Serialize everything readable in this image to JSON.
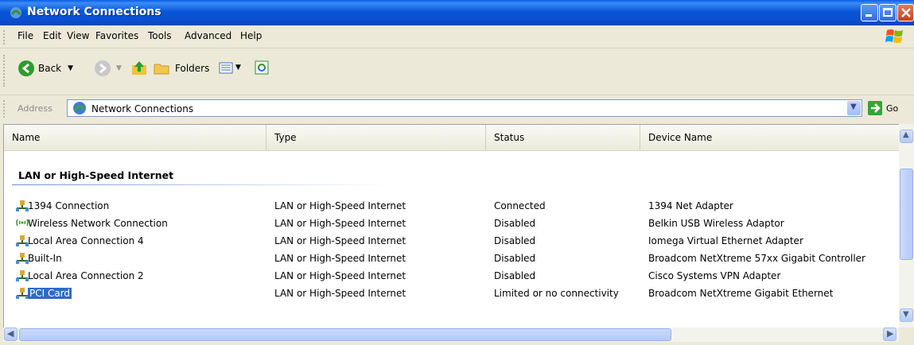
{
  "window": {
    "title": "Network Connections",
    "title_icon": "network-connections-icon",
    "controls": [
      "minimize-icon",
      "maximize-icon",
      "close-icon"
    ]
  },
  "menu": {
    "items": [
      {
        "label": "File"
      },
      {
        "label": "Edit"
      },
      {
        "label": "View"
      },
      {
        "label": "Favorites"
      },
      {
        "label": "Tools"
      },
      {
        "label": "Advanced"
      },
      {
        "label": "Help"
      }
    ]
  },
  "toolbar": {
    "back_label": "Back",
    "folders_label": "Folders"
  },
  "address": {
    "label": "Address",
    "value": "Network Connections",
    "go_label": "Go"
  },
  "columns": [
    "Name",
    "Type",
    "Status",
    "Device Name"
  ],
  "group": {
    "title": "LAN or High-Speed Internet"
  },
  "rows": [
    {
      "name": "1394 Connection",
      "type": "LAN or High-Speed Internet",
      "status": "Connected",
      "device": "1394 Net Adapter",
      "icon": "lan-connection-icon"
    },
    {
      "name": "Wireless Network Connection",
      "type": "LAN or High-Speed Internet",
      "status": "Disabled",
      "device": "Belkin USB Wireless Adaptor",
      "icon": "wireless-connection-icon"
    },
    {
      "name": "Local Area Connection 4",
      "type": "LAN or High-Speed Internet",
      "status": "Disabled",
      "device": "Iomega Virtual Ethernet Adapter",
      "icon": "lan-connection-icon"
    },
    {
      "name": "Built-In",
      "type": "LAN or High-Speed Internet",
      "status": "Disabled",
      "device": "Broadcom NetXtreme 57xx Gigabit Controller",
      "icon": "lan-connection-icon"
    },
    {
      "name": "Local Area Connection 2",
      "type": "LAN or High-Speed Internet",
      "status": "Disabled",
      "device": "Cisco Systems VPN Adapter",
      "icon": "lan-connection-icon"
    },
    {
      "name": "PCI Card",
      "type": "LAN or High-Speed Internet",
      "status": "Limited or no connectivity",
      "device": "Broadcom NetXtreme Gigabit Ethernet",
      "icon": "lan-connection-icon",
      "selected": true
    }
  ],
  "colors": {
    "titlebar": "#0a4fd0",
    "selection": "#316ac5",
    "chrome": "#ece9d8"
  }
}
